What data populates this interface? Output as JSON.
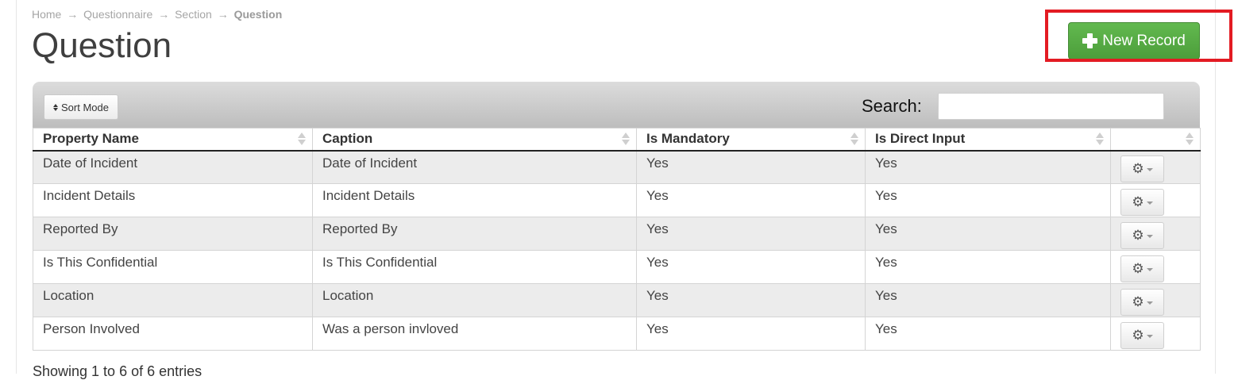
{
  "breadcrumb": {
    "items": [
      "Home",
      "Questionnaire",
      "Section"
    ],
    "separator": "→",
    "current": "Question"
  },
  "page_title": "Question",
  "new_record_label": "New Record",
  "toolbar": {
    "sort_mode_label": "Sort Mode",
    "search_label": "Search:",
    "search_value": ""
  },
  "table": {
    "headers": [
      "Property Name",
      "Caption",
      "Is Mandatory",
      "Is Direct Input",
      ""
    ],
    "rows": [
      [
        "Date of Incident",
        "Date of Incident",
        "Yes",
        "Yes"
      ],
      [
        "Incident Details",
        "Incident Details",
        "Yes",
        "Yes"
      ],
      [
        "Reported By",
        "Reported By",
        "Yes",
        "Yes"
      ],
      [
        "Is This Confidential",
        "Is This Confidential",
        "Yes",
        "Yes"
      ],
      [
        "Location",
        "Location",
        "Yes",
        "Yes"
      ],
      [
        "Person Involved",
        "Was a person invloved",
        "Yes",
        "Yes"
      ]
    ]
  },
  "footer": {
    "entries_info": "Showing 1 to 6 of 6 entries"
  },
  "colors": {
    "accent_green": "#5cb349",
    "highlight_red": "#e31b23"
  },
  "icons": {
    "new_record": "plus-icon",
    "sort_mode": "sort-icon",
    "row_action": "gear-icon"
  }
}
